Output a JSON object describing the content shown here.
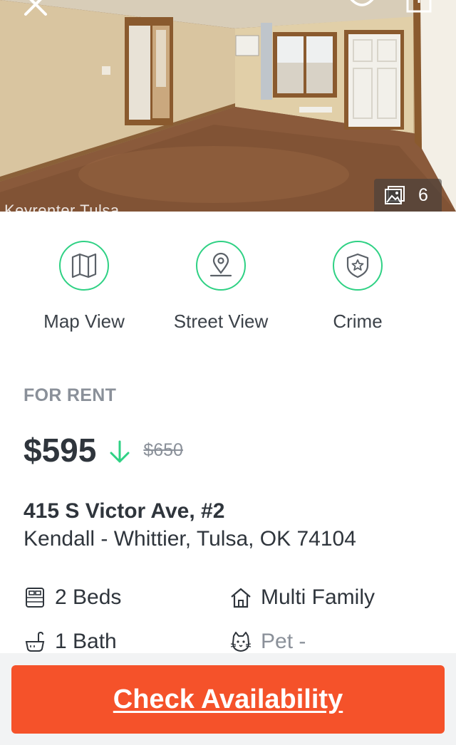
{
  "hero": {
    "watermark": "Keyrenter Tulsa",
    "photo_count": "6",
    "close_icon": "close-icon",
    "favorite_icon": "heart-icon",
    "share_icon": "share-icon"
  },
  "actions": [
    {
      "label": "Map View",
      "icon": "map-icon"
    },
    {
      "label": "Street View",
      "icon": "location-pin-icon"
    },
    {
      "label": "Crime",
      "icon": "shield-star-icon"
    }
  ],
  "listing": {
    "status": "FOR RENT",
    "price": "$595",
    "old_price": "$650",
    "street": "415 S Victor Ave, #2",
    "locality": "Kendall - Whittier, Tulsa, OK 74104"
  },
  "features": {
    "beds": "2 Beds",
    "type": "Multi Family",
    "baths": "1 Bath",
    "pets": "Pet -"
  },
  "cta": {
    "label": "Check Availability"
  },
  "colors": {
    "accent_green": "#2fd184",
    "cta_orange": "#f5522a",
    "text_dark": "#2f353c",
    "text_muted": "#8a9099"
  }
}
